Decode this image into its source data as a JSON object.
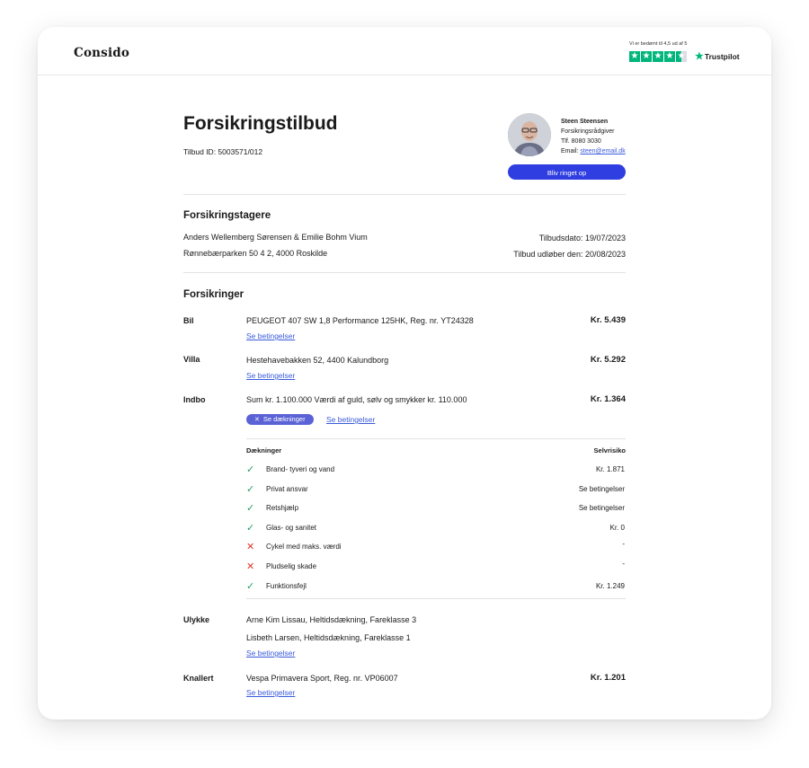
{
  "brand": {
    "logo_text": "Consido"
  },
  "trustpilot": {
    "rating_text": "Vi er bedømt til 4,5 ud af 5",
    "brand_label": "Trustpilot",
    "stars": 4.5,
    "star_color": "#00b67a"
  },
  "offer": {
    "title": "Forsikringstilbud",
    "id_label": "Tilbud ID: 5003571/012"
  },
  "advisor": {
    "name": "Steen Steensen",
    "role": "Forsikringsrådgiver",
    "phone": "Tlf. 8080 3030",
    "email_label": "Email: ",
    "email": "steen@email.dk",
    "call_button": "Bliv ringet op"
  },
  "policyholders": {
    "heading": "Forsikringstagere",
    "names": "Anders Wellemberg Sørensen & Emilie Bohm Vium",
    "address": "Rønnebærparken 50 4 2, 4000 Roskilde",
    "offer_date": "Tilbudsdato: 19/07/2023",
    "expiry_date": "Tilbud udløber den: 20/08/2023"
  },
  "insurances": {
    "heading": "Forsikringer",
    "items": [
      {
        "category": "Bil",
        "description": "PEUGEOT 407 SW 1,8 Performance 125HK, Reg. nr. YT24328",
        "price": "Kr. 5.439",
        "link": "Se betingelser"
      },
      {
        "category": "Villa",
        "description": "Hestehavebakken 52, 4400 Kalundborg",
        "price": "Kr. 5.292",
        "link": "Se betingelser"
      },
      {
        "category": "Indbo",
        "description": "Sum kr. 1.100.000 Værdi af guld, sølv og smykker kr. 110.000",
        "price": "Kr. 1.364",
        "pill": "Se dækninger",
        "link": "Se betingelser"
      },
      {
        "category": "Ulykke",
        "description": "Arne Kim Lissau, Heltidsdækning, Fareklasse 3",
        "description2": "Lisbeth Larsen, Heltidsdækning, Fareklasse 1",
        "link": "Se betingelser"
      },
      {
        "category": "Knallert",
        "description": "Vespa Primavera Sport, Reg. nr. VP06007",
        "price": "Kr. 1.201",
        "link": "Se betingelser"
      }
    ]
  },
  "coverage": {
    "header_left": "Dækninger",
    "header_right": "Selvrisiko",
    "rows": [
      {
        "name": "Brand- tyveri og vand",
        "value": "Kr. 1.871",
        "covered": true
      },
      {
        "name": "Privat ansvar",
        "value": "Se betingelser",
        "covered": true
      },
      {
        "name": "Retshjælp",
        "value": "Se betingelser",
        "covered": true
      },
      {
        "name": "Glas- og sanitet",
        "value": "Kr. 0",
        "covered": true
      },
      {
        "name": "Cykel med maks. værdi",
        "value": "-",
        "covered": false
      },
      {
        "name": "Pludselig skade",
        "value": "-",
        "covered": false
      },
      {
        "name": "Funktionsfejl",
        "value": "Kr. 1.249",
        "covered": true
      }
    ]
  },
  "colors": {
    "accent": "#2f3ee0",
    "pill": "#5b62d6",
    "link": "#3b5bdb",
    "check": "#24a062",
    "cross": "#e0352b"
  }
}
